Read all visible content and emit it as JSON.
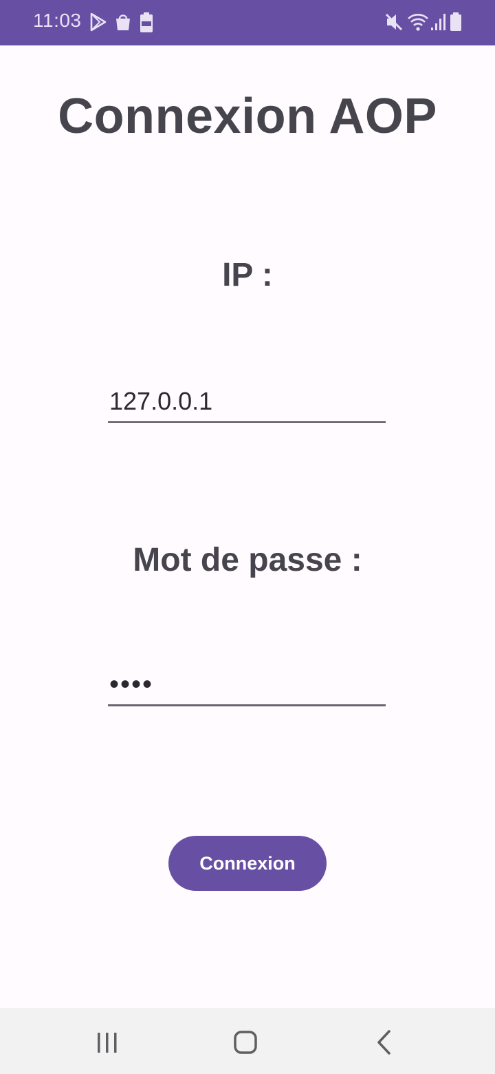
{
  "status_bar": {
    "time": "11:03",
    "left_icons": [
      "play-store-icon",
      "shopping-bag-icon",
      "battery-saver-icon"
    ],
    "right_icons": [
      "mute-icon",
      "wifi-icon",
      "signal-icon",
      "battery-icon"
    ],
    "color": "#6750a4"
  },
  "header": {
    "title": "Connexion AOP"
  },
  "form": {
    "ip_label": "IP :",
    "ip_value": "127.0.0.1",
    "password_label": "Mot de passe :",
    "password_value": "••••",
    "submit_label": "Connexion"
  },
  "nav_bar": {
    "buttons": [
      "recent-apps-icon",
      "home-icon",
      "back-icon"
    ]
  },
  "colors": {
    "accent": "#6750a4",
    "background": "#fffbfe",
    "text": "#46444d"
  }
}
